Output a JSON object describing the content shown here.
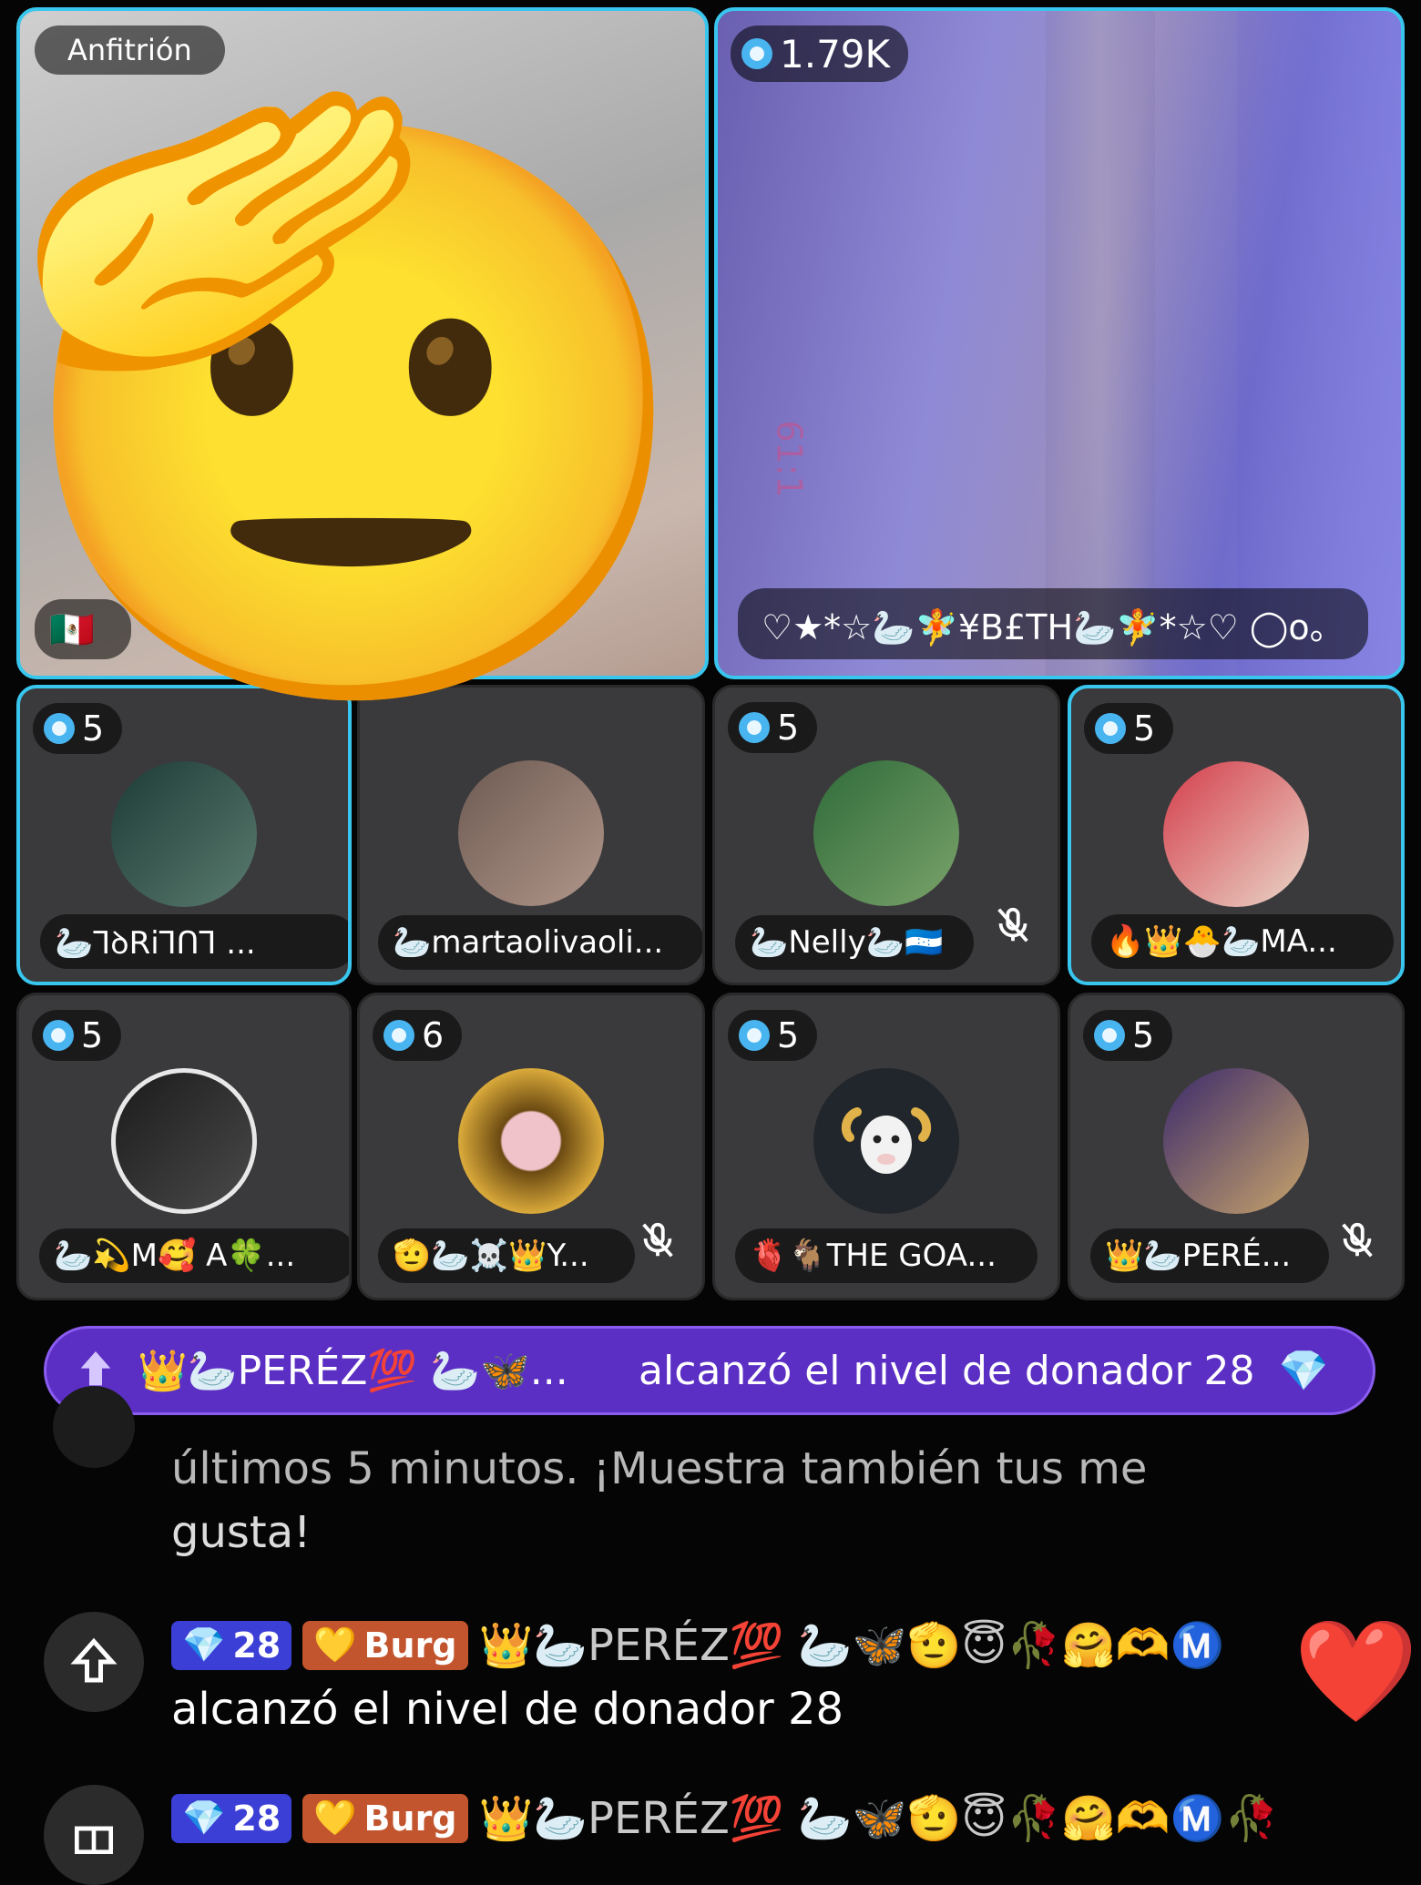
{
  "host_tile": {
    "label": "Anfitrión",
    "flag": "🇲🇽"
  },
  "guest_tile": {
    "viewer_count": "1.79K",
    "name": "♡★*☆🦢🧚¥B£TH🦢🧚*☆♡ ◯o。",
    "mirrored_text": "61:1"
  },
  "overlay_emoji": "🫡",
  "seats": [
    {
      "count": "5",
      "name": "🦢ꓶꝺRiꓶꓵꓶ ...",
      "active": true,
      "muted": false,
      "avatar_colors": [
        "#1d3b36",
        "#5a7b6f"
      ]
    },
    {
      "count": "",
      "name": "🦢martaolivaoli...",
      "active": false,
      "muted": false,
      "avatar_colors": [
        "#6d5a52",
        "#b1968a"
      ]
    },
    {
      "count": "5",
      "name": "🦢Nelly🦢🇭🇳",
      "active": false,
      "muted": true,
      "avatar_colors": [
        "#2f6a3a",
        "#7aa36a"
      ]
    },
    {
      "count": "5",
      "name": "🔥👑🐣🦢MA...",
      "active": true,
      "muted": false,
      "avatar_colors": [
        "#d43c4b",
        "#e9d8c9"
      ]
    },
    {
      "count": "5",
      "name": "🦢💫M🥰 A🍀...",
      "active": false,
      "muted": false,
      "avatar_colors": [
        "#1b1b1b",
        "#4a4a4a"
      ]
    },
    {
      "count": "6",
      "name": "🫡🦢☠️👑Y...",
      "active": false,
      "muted": true,
      "avatar_colors": [
        "#6b4a12",
        "#d9a93a"
      ]
    },
    {
      "count": "5",
      "name": "🫀🐐THE GOA...",
      "active": false,
      "muted": false,
      "avatar_colors": [
        "#20262b",
        "#384048"
      ]
    },
    {
      "count": "5",
      "name": "👑🦢PERÉ...",
      "active": false,
      "muted": true,
      "avatar_colors": [
        "#3a2a6b",
        "#c9a46b"
      ]
    }
  ],
  "banner": {
    "user": "👑🦢PERÉZ💯 🦢🦋...",
    "message": "alcanzó el nivel de donador 28",
    "gem": "💎"
  },
  "chat": {
    "system_line_1": "últimos 5 minutos. ¡Muestra también tus me",
    "system_line_2": "gusta!",
    "msg1": {
      "level": "28",
      "club": "Burg",
      "user": "👑🦢PERÉZ💯 🦢🦋🫡😇🥀🤗🫶Ⓜ️",
      "text": "alcanzó el nivel de donador 28"
    },
    "msg2": {
      "level": "28",
      "club": "Burg",
      "user": "👑🦢PERÉZ💯 🦢🦋🫡😇🥀🤗🫶Ⓜ️🥀"
    }
  },
  "colors": {
    "accent_cyan": "#39c6ee",
    "banner_purple": "#5b2fc4",
    "level_badge": "#3b3fd6",
    "club_badge": "#c2552e"
  }
}
